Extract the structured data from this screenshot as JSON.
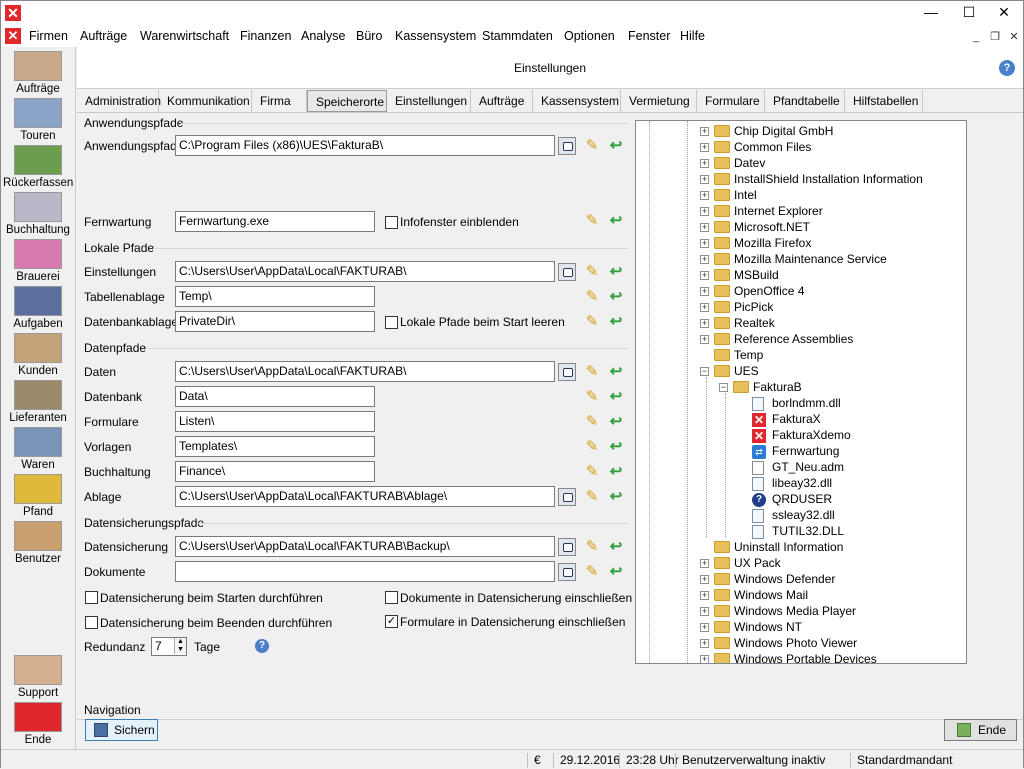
{
  "window": {
    "minimize": "—",
    "maximize": "☐",
    "close": "✕"
  },
  "menu": [
    "Firmen",
    "Aufträge",
    "Warenwirtschaft",
    "Finanzen",
    "Analyse",
    "Büro",
    "Kassensystem",
    "Stammdaten",
    "Optionen",
    "Fenster",
    "Hilfe"
  ],
  "leftbar": [
    {
      "label": "Aufträge",
      "color": "#c9a98a"
    },
    {
      "label": "Touren",
      "color": "#8ba3c7"
    },
    {
      "label": "Rückerfassen",
      "color": "#6a9e4d"
    },
    {
      "label": "Buchhaltung",
      "color": "#b8b8c8"
    },
    {
      "label": "Brauerei",
      "color": "#d67ab0"
    },
    {
      "label": "Aufgaben",
      "color": "#5a6f9b"
    },
    {
      "label": "Kunden",
      "color": "#c4a27a"
    },
    {
      "label": "Lieferanten",
      "color": "#9b8a6a"
    },
    {
      "label": "Waren",
      "color": "#7a93b8"
    },
    {
      "label": "Pfand",
      "color": "#e0b83a"
    },
    {
      "label": "Benutzer",
      "color": "#c8a070"
    }
  ],
  "leftbar_bottom": [
    {
      "label": "Support",
      "color": "#d4b090"
    },
    {
      "label": "Ende",
      "color": "#e0282c"
    }
  ],
  "header": {
    "title": "Einstellungen",
    "help": "?"
  },
  "tabs": [
    "Administration",
    "Kommunikation",
    "Firma",
    "Speicherorte",
    "Einstellungen",
    "Aufträge",
    "Kassensystem",
    "Vermietung",
    "Formulare",
    "Pfandtabelle",
    "Hilfstabellen"
  ],
  "active_tab": "Speicherorte",
  "groups": {
    "anwendung": {
      "title": "Anwendungspfade",
      "anwendungspfad_label": "Anwendungspfad",
      "anwendungspfad_value": "C:\\Program Files (x86)\\UES\\FakturaB\\",
      "fernwartung_label": "Fernwartung",
      "fernwartung_value": "Fernwartung.exe",
      "infofenster_label": "Infofenster einblenden"
    },
    "lokal": {
      "title": "Lokale Pfade",
      "einstellungen_label": "Einstellungen",
      "einstellungen_value": "C:\\Users\\User\\AppData\\Local\\FAKTURAB\\",
      "tabellen_label": "Tabellenablage",
      "tabellen_value": "Temp\\",
      "datenbank_label": "Datenbankablage",
      "datenbank_value": "PrivateDir\\",
      "leeren_label": "Lokale Pfade beim Start leeren"
    },
    "daten": {
      "title": "Datenpfade",
      "rows": [
        {
          "label": "Daten",
          "value": "C:\\Users\\User\\AppData\\Local\\FAKTURAB\\"
        },
        {
          "label": "Datenbank",
          "value": "Data\\"
        },
        {
          "label": "Formulare",
          "value": "Listen\\"
        },
        {
          "label": "Vorlagen",
          "value": "Templates\\"
        },
        {
          "label": "Buchhaltung",
          "value": "Finance\\"
        },
        {
          "label": "Ablage",
          "value": "C:\\Users\\User\\AppData\\Local\\FAKTURAB\\Ablage\\"
        }
      ]
    },
    "sicherung": {
      "title": "Datensicherungspfade",
      "ds_label": "Datensicherung",
      "ds_value": "C:\\Users\\User\\AppData\\Local\\FAKTURAB\\Backup\\",
      "dok_label": "Dokumente",
      "dok_value": "",
      "cb_start": "Datensicherung beim Starten durchführen",
      "cb_ende": "Datensicherung beim Beenden durchführen",
      "cb_dok": "Dokumente in Datensicherung einschließen",
      "cb_form": "Formulare in Datensicherung einschließen",
      "cb_form_checked": "✓",
      "redundanz_label": "Redundanz",
      "redundanz_value": "7",
      "tage_label": "Tage",
      "help": "?"
    }
  },
  "tree": [
    {
      "label": "Chip Digital GmbH",
      "level": 0,
      "type": "folder",
      "exp": "+"
    },
    {
      "label": "Common Files",
      "level": 0,
      "type": "folder",
      "exp": "+"
    },
    {
      "label": "Datev",
      "level": 0,
      "type": "folder",
      "exp": "+"
    },
    {
      "label": "InstallShield Installation Information",
      "level": 0,
      "type": "folder",
      "exp": "+"
    },
    {
      "label": "Intel",
      "level": 0,
      "type": "folder",
      "exp": "+"
    },
    {
      "label": "Internet Explorer",
      "level": 0,
      "type": "folder",
      "exp": "+"
    },
    {
      "label": "Microsoft.NET",
      "level": 0,
      "type": "folder",
      "exp": "+"
    },
    {
      "label": "Mozilla Firefox",
      "level": 0,
      "type": "folder",
      "exp": "+"
    },
    {
      "label": "Mozilla Maintenance Service",
      "level": 0,
      "type": "folder",
      "exp": "+"
    },
    {
      "label": "MSBuild",
      "level": 0,
      "type": "folder",
      "exp": "+"
    },
    {
      "label": "OpenOffice 4",
      "level": 0,
      "type": "folder",
      "exp": "+"
    },
    {
      "label": "PicPick",
      "level": 0,
      "type": "folder",
      "exp": "+"
    },
    {
      "label": "Realtek",
      "level": 0,
      "type": "folder",
      "exp": "+"
    },
    {
      "label": "Reference Assemblies",
      "level": 0,
      "type": "folder",
      "exp": "+"
    },
    {
      "label": "Temp",
      "level": 0,
      "type": "folder",
      "exp": ""
    },
    {
      "label": "UES",
      "level": 0,
      "type": "folder",
      "exp": "−"
    },
    {
      "label": "FakturaB",
      "level": 1,
      "type": "folder",
      "exp": "−"
    },
    {
      "label": "borlndmm.dll",
      "level": 2,
      "type": "dll",
      "exp": ""
    },
    {
      "label": "FakturaX",
      "level": 2,
      "type": "x",
      "exp": ""
    },
    {
      "label": "FakturaXdemo",
      "level": 2,
      "type": "x",
      "exp": ""
    },
    {
      "label": "Fernwartung",
      "level": 2,
      "type": "tv",
      "exp": ""
    },
    {
      "label": "GT_Neu.adm",
      "level": 2,
      "type": "plain",
      "exp": ""
    },
    {
      "label": "libeay32.dll",
      "level": 2,
      "type": "dll",
      "exp": ""
    },
    {
      "label": "QRDUSER",
      "level": 2,
      "type": "q",
      "exp": ""
    },
    {
      "label": "ssleay32.dll",
      "level": 2,
      "type": "dll",
      "exp": ""
    },
    {
      "label": "TUTIL32.DLL",
      "level": 2,
      "type": "dll",
      "exp": ""
    },
    {
      "label": "Uninstall Information",
      "level": 0,
      "type": "folder",
      "exp": ""
    },
    {
      "label": "UX Pack",
      "level": 0,
      "type": "folder",
      "exp": "+"
    },
    {
      "label": "Windows Defender",
      "level": 0,
      "type": "folder",
      "exp": "+"
    },
    {
      "label": "Windows Mail",
      "level": 0,
      "type": "folder",
      "exp": "+"
    },
    {
      "label": "Windows Media Player",
      "level": 0,
      "type": "folder",
      "exp": "+"
    },
    {
      "label": "Windows NT",
      "level": 0,
      "type": "folder",
      "exp": "+"
    },
    {
      "label": "Windows Photo Viewer",
      "level": 0,
      "type": "folder",
      "exp": "+"
    },
    {
      "label": "Windows Portable Devices",
      "level": 0,
      "type": "folder",
      "exp": "+"
    }
  ],
  "tree_scroll": {
    "up": "▲",
    "down": "▼"
  },
  "bottom": {
    "navigation_label": "Navigation",
    "save_label": "Sichern",
    "end_label": "Ende"
  },
  "status": {
    "currency": "€",
    "date": "29.12.2016",
    "time": "23:28 Uhr",
    "user": "Benutzerverwaltung inaktiv",
    "mandant": "Standardmandant"
  }
}
